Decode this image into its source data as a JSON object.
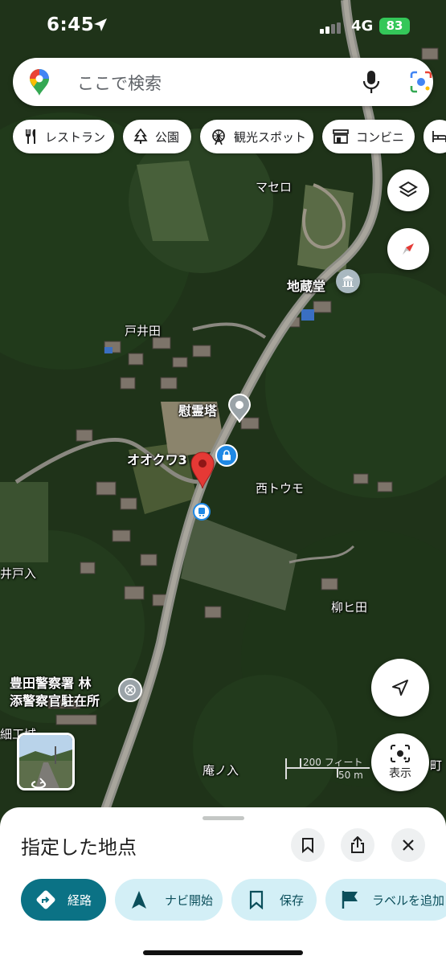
{
  "status_bar": {
    "time": "6:45",
    "network": "4G",
    "battery": "83"
  },
  "search": {
    "placeholder": "ここで検索"
  },
  "chips": [
    {
      "label": "レストラン",
      "icon": "fork-knife-icon"
    },
    {
      "label": "公園",
      "icon": "tree-icon"
    },
    {
      "label": "観光スポット",
      "icon": "ferris-wheel-icon"
    },
    {
      "label": "コンビニ",
      "icon": "store-icon"
    }
  ],
  "map_labels": {
    "maseiro": "マセロ",
    "jizodo": "地蔵堂",
    "toida": "戸井田",
    "ireito": "慰霊塔",
    "ookuwa": "オオクワ3",
    "nishi_toumo": "西トウモ",
    "idoiri": "井戸入",
    "yanagihida": "柳ヒ田",
    "police": "豊田警察署 林\n添警察官駐在所",
    "saiku": "細工城",
    "annoiri": "庵ノ入",
    "machi": "町"
  },
  "scale": {
    "feet": "200 フィート",
    "meters": "50 m"
  },
  "display_button": {
    "label": "表示"
  },
  "sheet": {
    "title": "指定した地点",
    "actions": [
      {
        "label": "経路",
        "icon": "directions-icon"
      },
      {
        "label": "ナビ開始",
        "icon": "navigation-arrow-icon"
      },
      {
        "label": "保存",
        "icon": "bookmark-icon"
      },
      {
        "label": "ラベルを追加",
        "icon": "flag-icon"
      }
    ]
  },
  "colors": {
    "accent": "#0b7285",
    "pin_red": "#e53935",
    "chip_bg": "#ffffff",
    "action_bg": "#d3eff6"
  }
}
